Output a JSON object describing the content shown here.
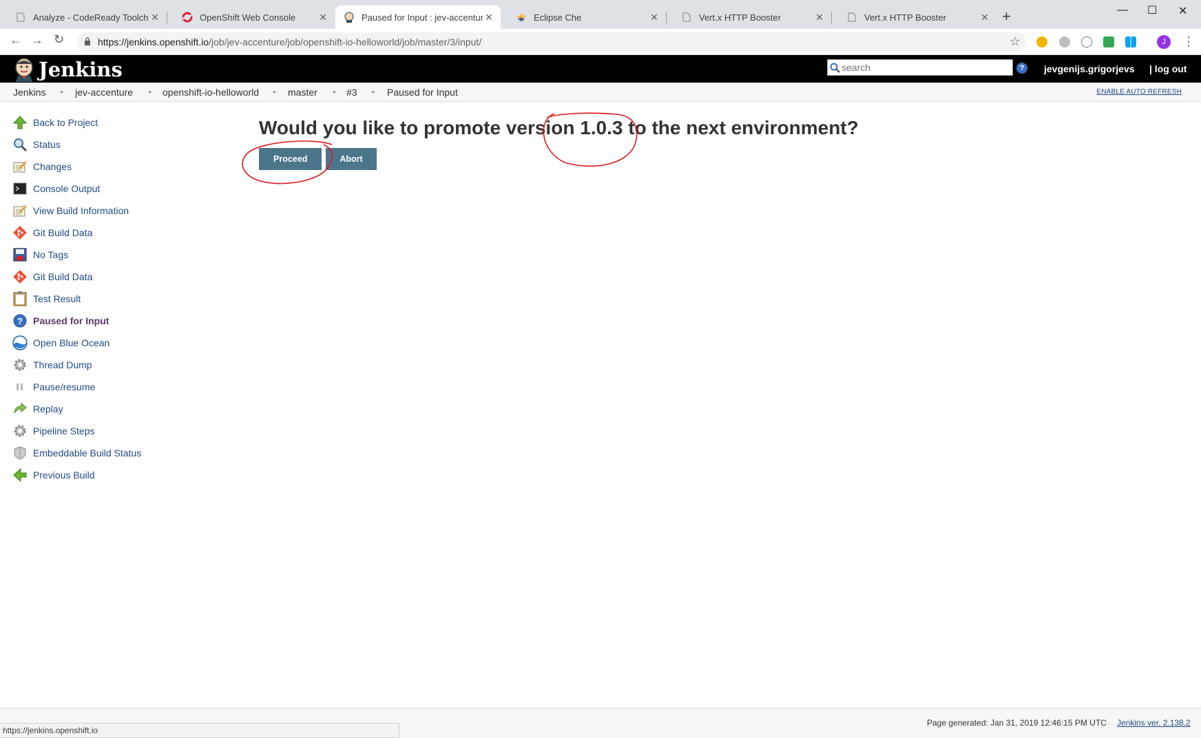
{
  "browser": {
    "tabs": [
      {
        "title": "Analyze - CodeReady Toolchain",
        "icon": "document-icon"
      },
      {
        "title": "OpenShift Web Console",
        "icon": "openshift-icon"
      },
      {
        "title": "Paused for Input : jev-accenture/",
        "icon": "jenkins-icon",
        "active": true
      },
      {
        "title": "Eclipse Che",
        "icon": "che-icon"
      },
      {
        "title": "Vert.x HTTP Booster",
        "icon": "document-icon"
      },
      {
        "title": "Vert.x HTTP Booster",
        "icon": "document-icon"
      }
    ],
    "url_host": "https://jenkins.openshift.io",
    "url_path": "/job/jev-accenture/job/openshift-io-helloworld/job/master/3/input/",
    "avatar_letter": "J",
    "status_url": "https://jenkins.openshift.io"
  },
  "header": {
    "brand": "Jenkins",
    "search_placeholder": "search",
    "help": "?",
    "username": "jevgenijs.grigorjevs",
    "logout": "| log out"
  },
  "breadcrumbs": [
    "Jenkins",
    "jev-accenture",
    "openshift-io-helloworld",
    "master",
    "#3",
    "Paused for Input"
  ],
  "auto_refresh": "ENABLE AUTO REFRESH",
  "sidebar": {
    "items": [
      {
        "label": "Back to Project",
        "icon": "arrow-up-icon"
      },
      {
        "label": "Status",
        "icon": "magnifier-icon"
      },
      {
        "label": "Changes",
        "icon": "notepad-icon"
      },
      {
        "label": "Console Output",
        "icon": "terminal-icon"
      },
      {
        "label": "View Build Information",
        "icon": "notepad-icon"
      },
      {
        "label": "Git Build Data",
        "icon": "git-icon"
      },
      {
        "label": "No Tags",
        "icon": "floppy-icon"
      },
      {
        "label": "Git Build Data",
        "icon": "git-icon"
      },
      {
        "label": "Test Result",
        "icon": "clipboard-icon"
      },
      {
        "label": "Paused for Input",
        "icon": "help-icon",
        "current": true
      },
      {
        "label": "Open Blue Ocean",
        "icon": "blue-ocean-icon"
      },
      {
        "label": "Thread Dump",
        "icon": "gear-icon"
      },
      {
        "label": "Pause/resume",
        "icon": "pause-icon"
      },
      {
        "label": "Replay",
        "icon": "replay-arrow-icon"
      },
      {
        "label": "Pipeline Steps",
        "icon": "gear-icon"
      },
      {
        "label": "Embeddable Build Status",
        "icon": "shield-icon"
      },
      {
        "label": "Previous Build",
        "icon": "arrow-left-icon"
      }
    ]
  },
  "main": {
    "prompt": "Would you like to promote version 1.0.3 to the next environment?",
    "proceed_label": "Proceed",
    "abort_label": "Abort"
  },
  "footer": {
    "page_generated": "Page generated: Jan 31, 2019 12:46:15 PM UTC",
    "version": "Jenkins ver. 2.138.2"
  },
  "colors": {
    "button": "#4b758b",
    "link": "#204a87",
    "annotation": "#e0161c",
    "header_bg": "#000000"
  }
}
